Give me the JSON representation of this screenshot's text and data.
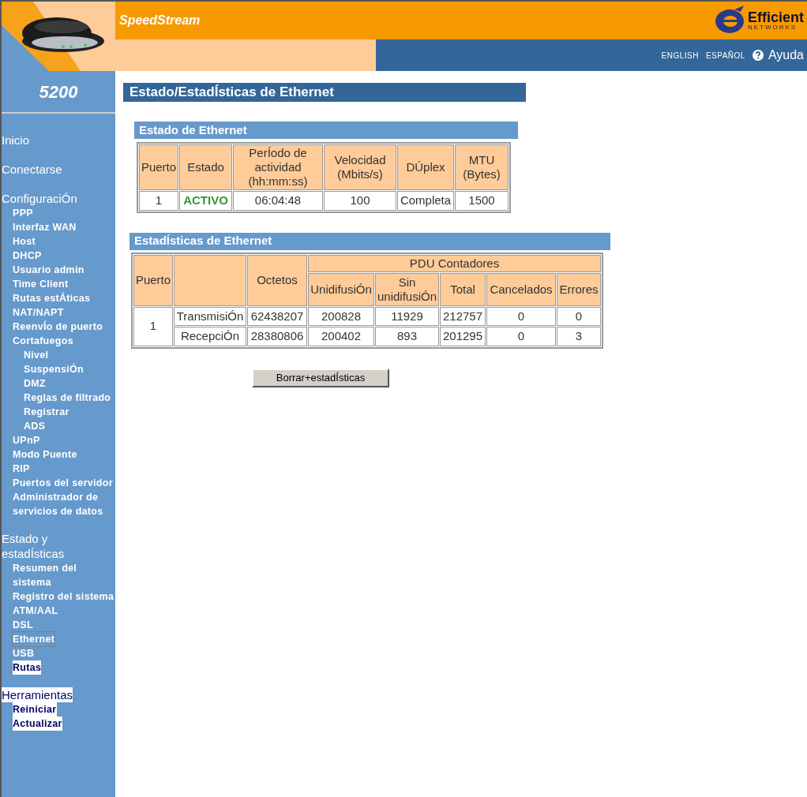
{
  "header": {
    "product": "SpeedStream",
    "company": "Efficient",
    "company_sub": "NETWORKS",
    "languages": [
      {
        "label": "ENGLISH"
      },
      {
        "label": "ESPAÑOL"
      }
    ],
    "help": "Ayuda"
  },
  "sidebar": {
    "model": "5200",
    "sections": [
      {
        "label": "Inicio",
        "highlighted": false
      },
      {
        "label": "Conectarse",
        "highlighted": false
      },
      {
        "label": "ConfiguraciÓn",
        "highlighted": false,
        "items": [
          {
            "label": "PPP",
            "highlighted": false,
            "selected": false
          },
          {
            "label": "Interfaz WAN",
            "highlighted": false,
            "selected": false
          },
          {
            "label": "Host",
            "highlighted": false,
            "selected": false
          },
          {
            "label": "DHCP",
            "highlighted": false,
            "selected": false
          },
          {
            "label": "Usuario admin",
            "highlighted": false,
            "selected": false
          },
          {
            "label": "Time Client",
            "highlighted": false,
            "selected": false
          },
          {
            "label": "Rutas estÁticas",
            "highlighted": false,
            "selected": false
          },
          {
            "label": "NAT/NAPT",
            "highlighted": false,
            "selected": false
          },
          {
            "label": "ReenvÍo de puerto",
            "highlighted": false,
            "selected": false
          },
          {
            "label": "Cortafuegos",
            "highlighted": false,
            "selected": false,
            "children": [
              {
                "label": "Nivel",
                "highlighted": false,
                "selected": false
              },
              {
                "label": "SuspensiÓn",
                "highlighted": false,
                "selected": false
              },
              {
                "label": "DMZ",
                "highlighted": false,
                "selected": false
              },
              {
                "label": "Reglas de filtrado",
                "highlighted": false,
                "selected": false
              },
              {
                "label": "Registrar",
                "highlighted": false,
                "selected": false
              },
              {
                "label": "ADS",
                "highlighted": false,
                "selected": false
              }
            ]
          },
          {
            "label": "UPnP",
            "highlighted": false,
            "selected": false
          },
          {
            "label": "Modo Puente",
            "highlighted": false,
            "selected": false
          },
          {
            "label": "RIP",
            "highlighted": false,
            "selected": false
          },
          {
            "label": "Puertos del servidor",
            "highlighted": false,
            "selected": false
          },
          {
            "label": "Administrador de servicios de datos",
            "highlighted": false,
            "selected": false
          }
        ]
      },
      {
        "label": "Estado y estadÍsticas",
        "highlighted": false,
        "items": [
          {
            "label": "Resumen del sistema",
            "highlighted": false,
            "selected": false
          },
          {
            "label": "Registro del sistema",
            "highlighted": false,
            "selected": false
          },
          {
            "label": "ATM/AAL",
            "highlighted": false,
            "selected": false
          },
          {
            "label": "DSL",
            "highlighted": false,
            "selected": false
          },
          {
            "label": "Ethernet",
            "highlighted": false,
            "selected": true
          },
          {
            "label": "USB",
            "highlighted": false,
            "selected": false
          },
          {
            "label": "Rutas",
            "highlighted": true,
            "selected": false
          }
        ]
      },
      {
        "label": "Herramientas",
        "highlighted": true,
        "items": [
          {
            "label": "Reiniciar",
            "highlighted": true,
            "selected": false
          },
          {
            "label": "Actualizar",
            "highlighted": true,
            "selected": false
          }
        ]
      }
    ]
  },
  "page_title": "Estado/EstadÍsticas de Ethernet",
  "status_section": {
    "title": "Estado de Ethernet",
    "columns": [
      "Puerto",
      "Estado",
      "PerÍodo de actividad (hh:mm:ss)",
      "Velocidad (Mbits/s)",
      "DÚplex",
      "MTU (Bytes)"
    ],
    "rows": [
      {
        "port": "1",
        "state": "ACTIVO",
        "active": true,
        "uptime": "06:04:48",
        "speed": "100",
        "duplex": "Completa",
        "mtu": "1500"
      }
    ]
  },
  "stats_section": {
    "title": "EstadÍsticas de Ethernet",
    "columns": {
      "port": "Puerto",
      "octets": "Octetos",
      "group": "PDU Contadores",
      "sub": [
        "UnidifusiÓn",
        "Sin unidifusiÓn",
        "Total",
        "Cancelados",
        "Errores"
      ]
    },
    "port": "1",
    "rows": [
      {
        "direction": "TransmisiÓn",
        "octets": "62438207",
        "values": [
          "200828",
          "11929",
          "212757",
          "0",
          "0"
        ]
      },
      {
        "direction": "RecepciÓn",
        "octets": "28380806",
        "values": [
          "200402",
          "893",
          "201295",
          "0",
          "3"
        ]
      }
    ]
  },
  "clear_button": "Borrar+estadÍsticas"
}
